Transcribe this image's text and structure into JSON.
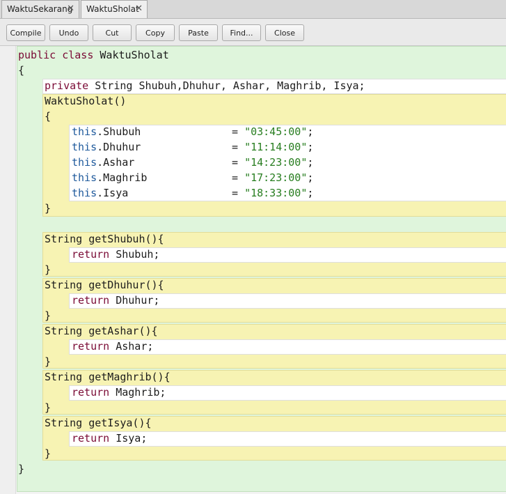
{
  "tabs": [
    {
      "label": "WaktuSekarang",
      "close": "✕"
    },
    {
      "label": "WaktuSholat",
      "close": "✕"
    }
  ],
  "toolbar": {
    "compile": "Compile",
    "undo": "Undo",
    "cut": "Cut",
    "copy": "Copy",
    "paste": "Paste",
    "find": "Find...",
    "close": "Close"
  },
  "code": {
    "class_kw1": "public",
    "class_kw2": "class",
    "class_name": "WaktuSholat",
    "open_brace": "{",
    "close_brace": "}",
    "field_kw": "private",
    "field_rest": " String Shubuh,Dhuhur, Ashar, Maghrib, Isya;",
    "ctor_sig": "WaktuSholat()",
    "ctor_open": "{",
    "ctor_close": "}",
    "this_kw": "this",
    "assignments": [
      {
        "field": ".Shubuh",
        "value": "\"03:45:00\""
      },
      {
        "field": ".Dhuhur",
        "value": "\"11:14:00\""
      },
      {
        "field": ".Ashar",
        "value": "\"14:23:00\""
      },
      {
        "field": ".Maghrib",
        "value": "\"17:23:00\""
      },
      {
        "field": ".Isya",
        "value": "\"18:33:00\""
      }
    ],
    "eq": "= ",
    "semicolon": ";",
    "return_kw": "return",
    "methods": [
      {
        "sig": "String getShubuh(){",
        "ret": " Shubuh;",
        "close": "}"
      },
      {
        "sig": "String getDhuhur(){",
        "ret": " Dhuhur;",
        "close": "}"
      },
      {
        "sig": "String getAshar(){",
        "ret": " Ashar;",
        "close": "}"
      },
      {
        "sig": "String getMaghrib(){",
        "ret": " Maghrib;",
        "close": "}"
      },
      {
        "sig": "String getIsya(){",
        "ret": " Isya;",
        "close": "}"
      }
    ]
  }
}
